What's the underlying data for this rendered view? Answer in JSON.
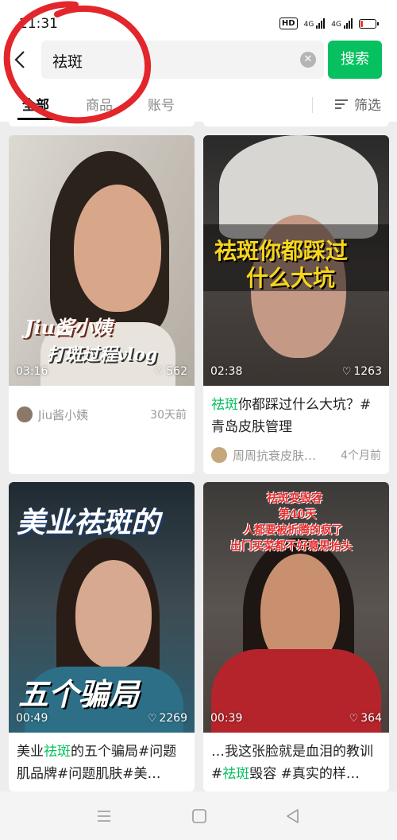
{
  "status_bar": {
    "time": "21:31",
    "hd": "HD",
    "net1": "4G",
    "net2": "4G",
    "battery_level": 0.18,
    "battery_color": "#e53935"
  },
  "search": {
    "back_icon": "chevron-left-icon",
    "query": "祛斑",
    "clear_icon": "clear-circle-icon",
    "button_label": "搜索",
    "accent": "#07c160"
  },
  "tabs": {
    "items": [
      "全部",
      "商品",
      "账号"
    ],
    "active": "全部",
    "filter_label": "筛选"
  },
  "cards": [
    {
      "duration": "03:16",
      "likes": "562",
      "overlay_line1": "Jiu酱小姨",
      "overlay_line2": "打斑过程vlog",
      "caption_prefix": "",
      "caption_highlight": "",
      "caption_rest": "",
      "author": "Jiu酱小姨",
      "when": "30天前"
    },
    {
      "duration": "02:38",
      "likes": "1263",
      "overlay_line1": "祛斑你都踩过",
      "overlay_line2": "什么大坑",
      "caption_prefix": "",
      "caption_highlight": "祛斑",
      "caption_rest": "你都踩过什么大坑？#青岛皮肤管理",
      "author": "周周抗衰皮肤…",
      "when": "4个月前"
    },
    {
      "duration": "00:49",
      "likes": "2269",
      "overlay_line1": "美业祛斑的",
      "overlay_line2": "五个骗局",
      "caption_prefix": "美业",
      "caption_highlight": "祛斑",
      "caption_rest": "的五个骗局#问题肌品牌#问题肌肤#美…",
      "author": "",
      "when": ""
    },
    {
      "duration": "00:39",
      "likes": "364",
      "overlay_line1": "祛斑变毁容",
      "overlay_line2": "第40天",
      "overlay_line3": "人都要被折腾的疯了",
      "overlay_line4": "出门买菜都不好意思抬头",
      "caption_prefix": "…我这张脸就是血泪的教训#",
      "caption_highlight": "祛斑",
      "caption_rest": "毁容 #真实的样…",
      "author": "",
      "when": ""
    }
  ],
  "nav": {
    "menu_icon": "menu-icon",
    "home_icon": "home-square-icon",
    "back_icon": "back-triangle-icon"
  }
}
